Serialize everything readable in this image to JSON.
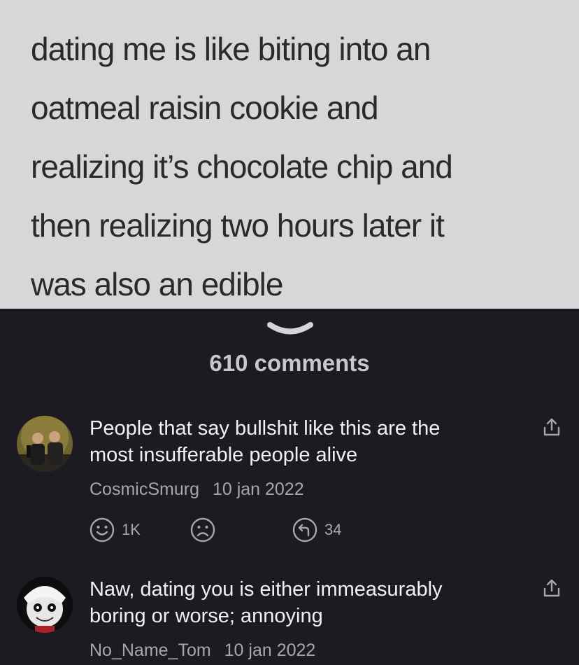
{
  "post": {
    "text_lines": [
      "dating me is like biting into an",
      "oatmeal raisin cookie and",
      "realizing it’s chocolate chip and",
      "then realizing two hours later it",
      "was also an edible"
    ]
  },
  "comments_count": "610 comments",
  "comments": [
    {
      "lines": [
        "People that say bullshit like this are the",
        "most insufferable people alive"
      ],
      "author": "CosmicSmurg",
      "date": "10 jan 2022",
      "upvotes": "1K",
      "replies": "34"
    },
    {
      "lines": [
        "Naw, dating you is either immeasurably",
        "boring or worse; annoying"
      ],
      "author": "No_Name_Tom",
      "date": "10 jan 2022"
    }
  ],
  "icons": {
    "expand": "chevron-down-icon",
    "share": "share-icon",
    "upvote": "smile-icon",
    "downvote": "frown-icon",
    "reply": "reply-icon"
  },
  "colors": {
    "background": "#1c1b21",
    "post_background": "#d7d7d9",
    "text_primary": "#f1f1f3",
    "text_secondary": "#a6a6ab"
  }
}
